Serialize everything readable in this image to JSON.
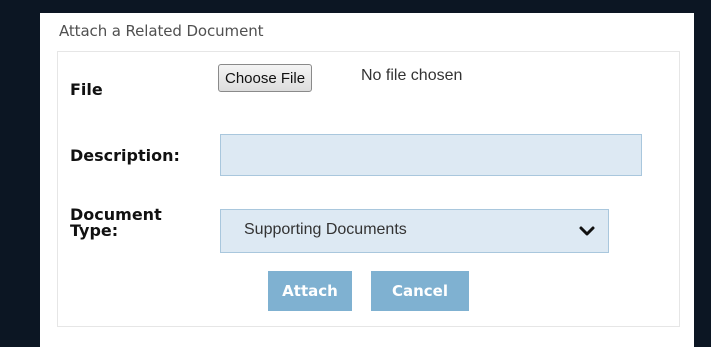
{
  "panel": {
    "title": "Attach a Related Document"
  },
  "form": {
    "file_label": "File",
    "choose_file_label": "Choose File",
    "file_status": "No file chosen",
    "description_label": "Description:",
    "description_value": "",
    "description_placeholder": "",
    "doc_type_label_line1": "Document",
    "doc_type_label_line2": "Type:",
    "doc_type_selected": "Supporting Documents"
  },
  "actions": {
    "attach_label": "Attach",
    "cancel_label": "Cancel"
  },
  "colors": {
    "background": "#0c1623",
    "field_fill": "#dde9f3",
    "field_border": "#a9c7dd",
    "button_fill": "#7fb1d1",
    "button_text": "#ffffff"
  },
  "icons": {
    "select_arrow": "chevron-down-icon"
  }
}
